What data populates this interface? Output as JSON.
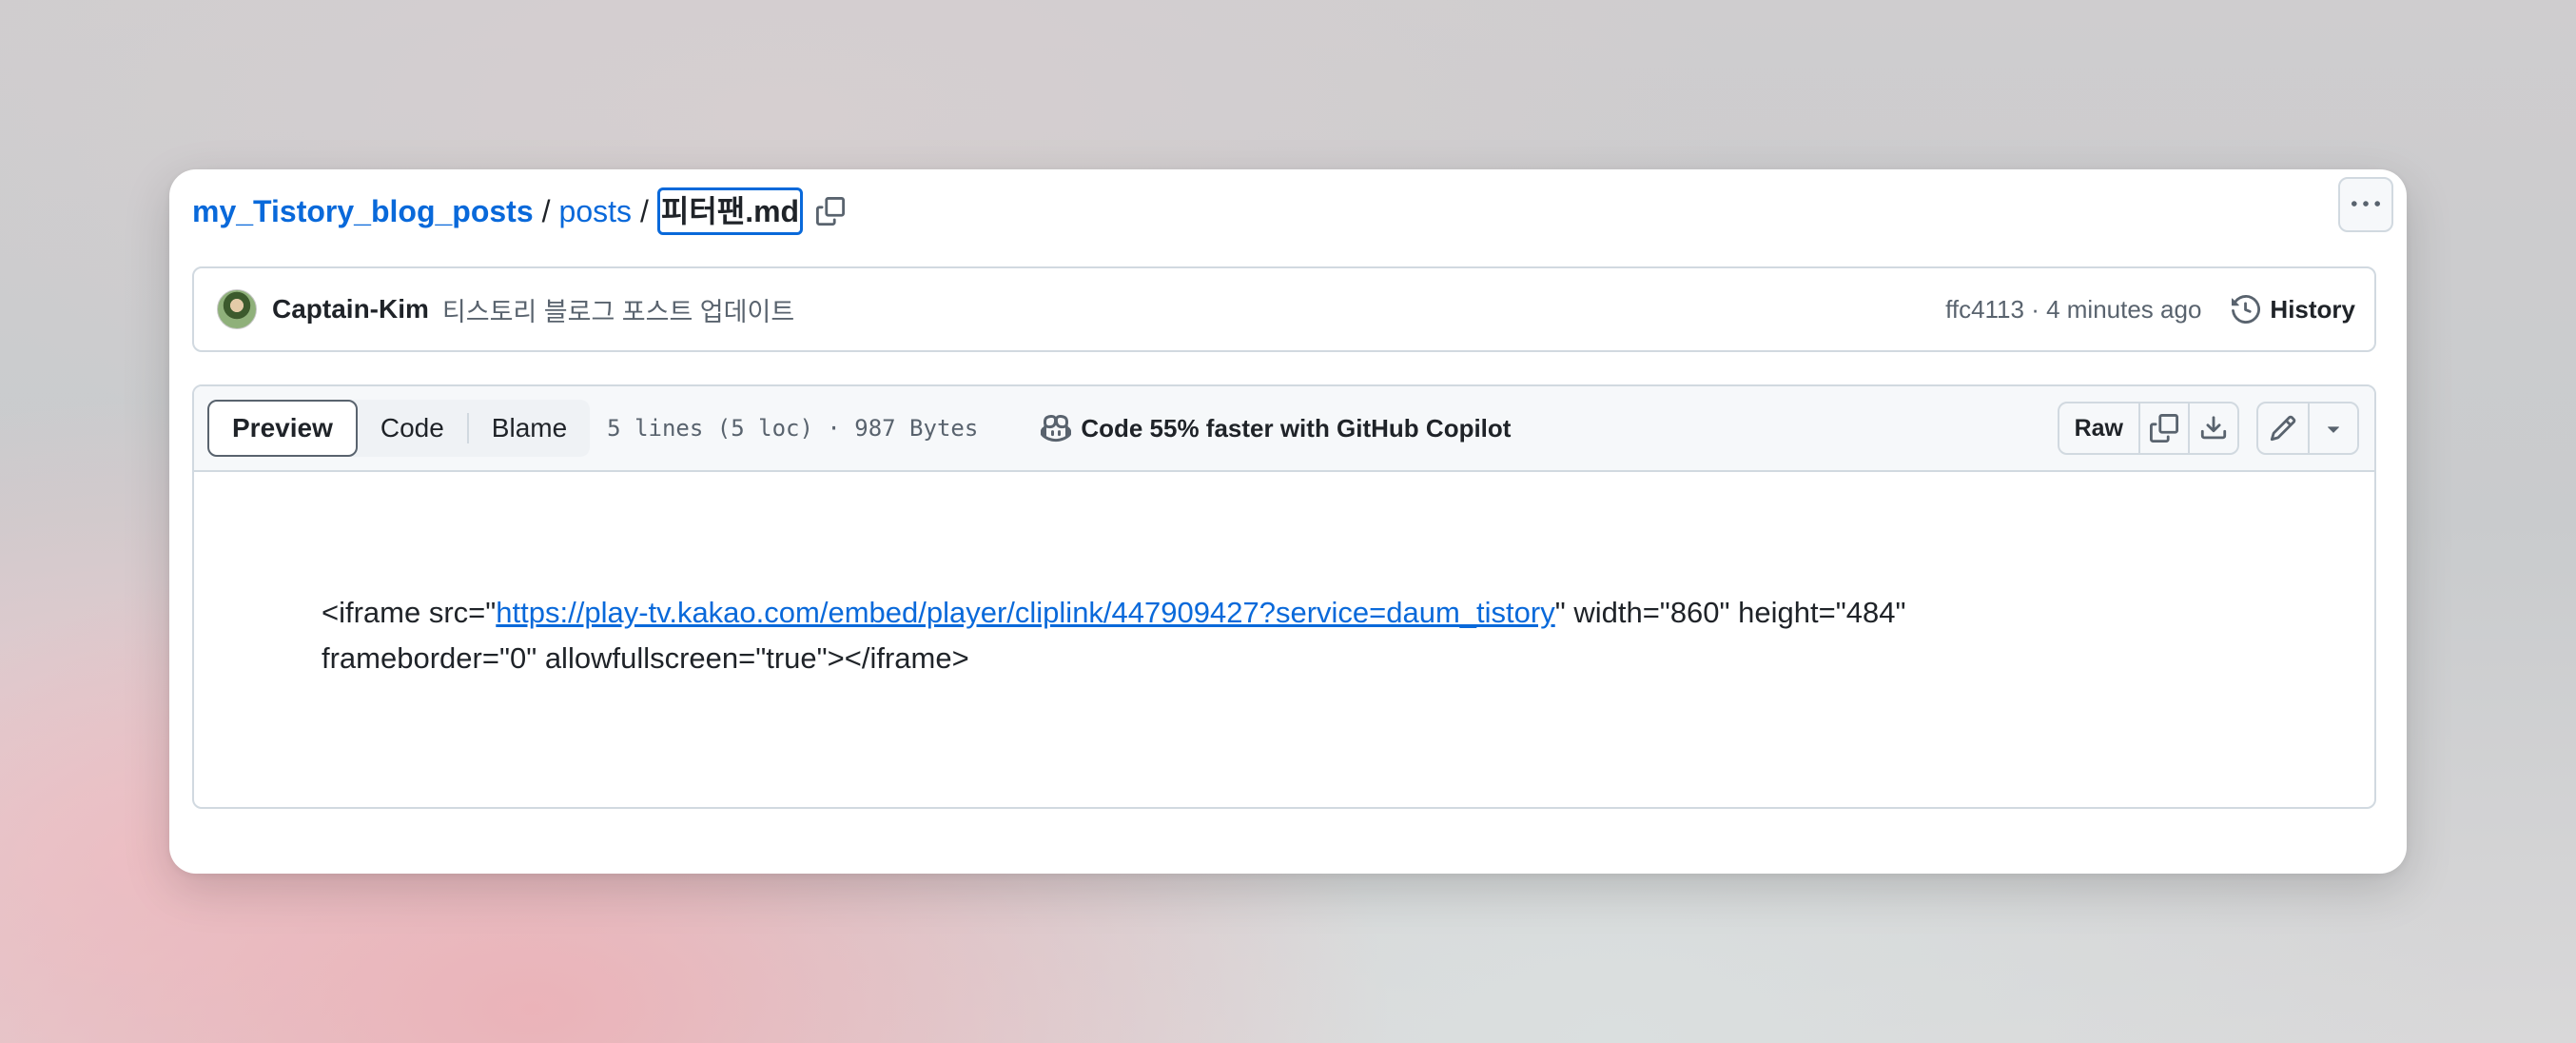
{
  "breadcrumb": {
    "repo": "my_Tistory_blog_posts",
    "separator": "/",
    "dir": "posts",
    "file": "피터팬.md"
  },
  "commit": {
    "author": "Captain-Kim",
    "message": "티스토리 블로그 포스트 업데이트",
    "sha_time": "ffc4113 · 4 minutes ago",
    "history_label": "History"
  },
  "file_header": {
    "tabs": [
      "Preview",
      "Code",
      "Blame"
    ],
    "active_tab": "Preview",
    "meta": "5 lines (5 loc) · 987 Bytes",
    "copilot": "Code 55% faster with GitHub Copilot",
    "raw_label": "Raw"
  },
  "content": {
    "prefix": "<iframe src=\"",
    "link": "https://play-tv.kakao.com/embed/player/cliplink/447909427?service=daum_tistory",
    "suffix": "\" width=\"860\" height=\"484\"",
    "line2": "frameborder=\"0\" allowfullscreen=\"true\"></iframe>"
  },
  "colors": {
    "accent": "#0969da",
    "text": "#1f2328",
    "muted": "#59636e",
    "border": "#d1d9e0"
  },
  "icons": [
    "copy-icon",
    "kebab-icon",
    "history-icon",
    "copilot-icon",
    "download-icon",
    "pencil-icon",
    "triangle-down-icon"
  ]
}
